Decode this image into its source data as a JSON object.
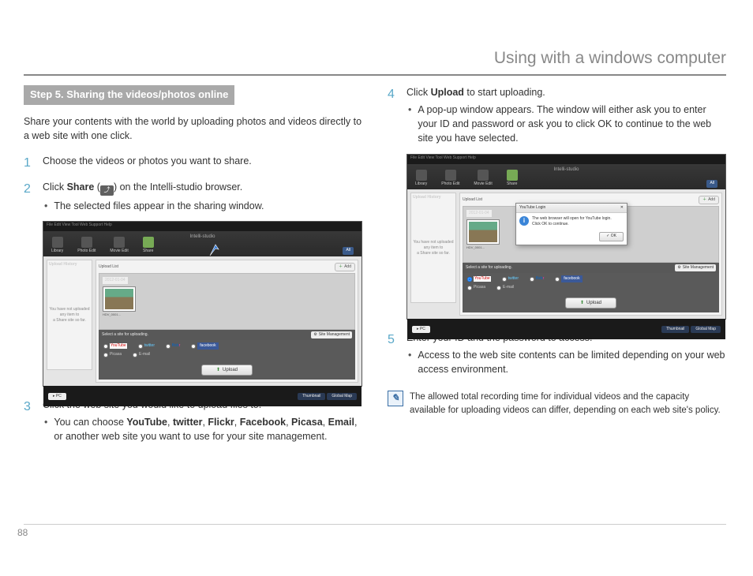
{
  "header": {
    "title": "Using with a windows computer"
  },
  "left": {
    "step_heading": "Step 5. Sharing the videos/photos online",
    "intro": "Share your contents with the world by uploading photos and videos directly to a web site with one click.",
    "step1": {
      "num": "1",
      "text": "Choose the videos or photos you want to share."
    },
    "step2": {
      "num": "2",
      "prefix": "Click ",
      "bold": "Share",
      "mid": " (",
      "suffix": ") on the Intelli-studio browser.",
      "bullet": "The selected files appear in the sharing window."
    },
    "step3": {
      "num": "3",
      "text": "Click the web site you would like to upload files to.",
      "bullet_pre": "You can choose ",
      "b1": "YouTube",
      "c1": ", ",
      "b2": "twitter",
      "c2": ", ",
      "b3": "Flickr",
      "c3": ", ",
      "b4": "Facebook",
      "c4": ", ",
      "b5": "Picasa",
      "c5": ", ",
      "b6": "Email",
      "bullet_post": ", or another web site you want to use for your site management."
    }
  },
  "right": {
    "step4": {
      "num": "4",
      "prefix": "Click ",
      "bold": "Upload",
      "suffix": " to start uploading.",
      "bullet": "A pop-up window appears. The window will either ask you to enter your ID and password or ask you to click OK to continue to the web site you have selected."
    },
    "step5": {
      "num": "5",
      "text": "Enter your ID and the password to access.",
      "bullet": "Access to the web site contents can be limited depending on your web access environment."
    },
    "note": "The allowed total recording time for individual videos and the capacity available for uploading videos can differ, depending on each web site's policy."
  },
  "ss": {
    "menubar": "File  Edit  View  Tool  Web Support  Help",
    "logo": "Intelli-studio",
    "tools": [
      "Library",
      "Photo Edit",
      "Movie Edit",
      "Share"
    ],
    "left_panel_title": "Upload History",
    "left_panel_note1": "You have not uploaded any item to",
    "left_panel_note2": "a Share site so far.",
    "upload_list": "Upload List",
    "add": "Add",
    "date": "2012-01-04",
    "thumb_name": "HDV_0001...",
    "select_label": "Select a site for uploading.",
    "site_mgmt": "Site Management",
    "services": {
      "youtube": "YouTube",
      "twitter": "twitter",
      "flickr": "flickr",
      "facebook": "facebook",
      "picasa": "Picasa",
      "email": "E-mail"
    },
    "upload_btn": "Upload",
    "pc": "PC",
    "footer_tabs": [
      "Thumbnail",
      "Global Map"
    ],
    "all": "All"
  },
  "popup": {
    "title": "YouTube Login",
    "line1": "The web browser will open for YouTube login.",
    "line2": "Click OK to continue.",
    "ok": "OK"
  },
  "page_number": "88"
}
